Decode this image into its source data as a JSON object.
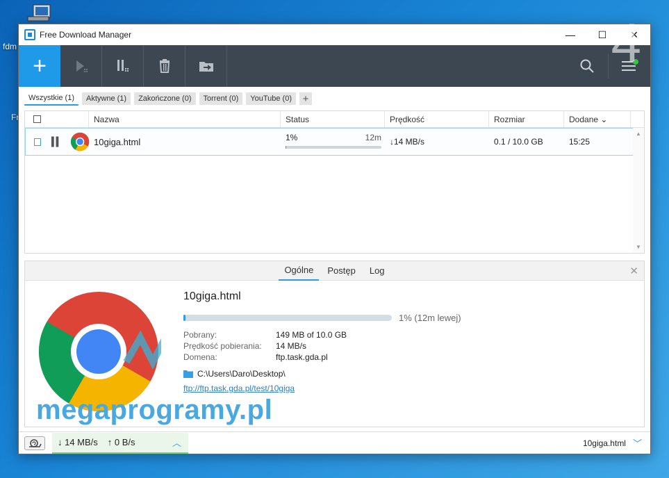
{
  "desktop": {
    "icon_label": "fdm",
    "second_label": "Fr",
    "corner_number": "4"
  },
  "window": {
    "title": "Free Download Manager",
    "controls": {
      "minimize": "—",
      "maximize": "☐",
      "close": "✕"
    }
  },
  "toolbar": {
    "add_label": "+"
  },
  "filters": [
    {
      "label": "Wszystkie (1)",
      "active": true
    },
    {
      "label": "Aktywne (1)",
      "active": false
    },
    {
      "label": "Zakończone (0)",
      "active": false
    },
    {
      "label": "Torrent (0)",
      "active": false
    },
    {
      "label": "YouTube (0)",
      "active": false
    }
  ],
  "filter_add": "+",
  "table": {
    "columns": {
      "name": "Nazwa",
      "status": "Status",
      "speed": "Prędkość",
      "size": "Rozmiar",
      "added": "Dodane ⌄"
    },
    "rows": [
      {
        "name": "10giga.html",
        "progress_percent": 1,
        "progress_label": "1%",
        "time_left": "12m",
        "speed": "↓14 MB/s",
        "size": "0.1 / 10.0 GB",
        "added": "15:25"
      }
    ]
  },
  "details": {
    "tabs": [
      "Ogólne",
      "Postęp",
      "Log"
    ],
    "active_tab": 0,
    "filename": "10giga.html",
    "progress_percent": 1,
    "progress_text": "1% (12m lewej)",
    "fields": [
      {
        "label": "Pobrany:",
        "value": "149 MB of 10.0 GB"
      },
      {
        "label": "Prędkość pobierania:",
        "value": "14 MB/s"
      },
      {
        "label": "Domena:",
        "value": "ftp.task.gda.pl"
      }
    ],
    "folder": "C:\\Users\\Daro\\Desktop\\",
    "url": "ftp://ftp.task.gda.pl/test/10giga"
  },
  "statusbar": {
    "down": "↓ 14 MB/s",
    "up": "↑ 0 B/s",
    "current_file": "10giga.html"
  },
  "watermark": "megaprogramy.pl",
  "colors": {
    "accent": "#1f9ae8",
    "toolbar_bg": "#3d4752",
    "speed_box": "#e9f6e9"
  }
}
